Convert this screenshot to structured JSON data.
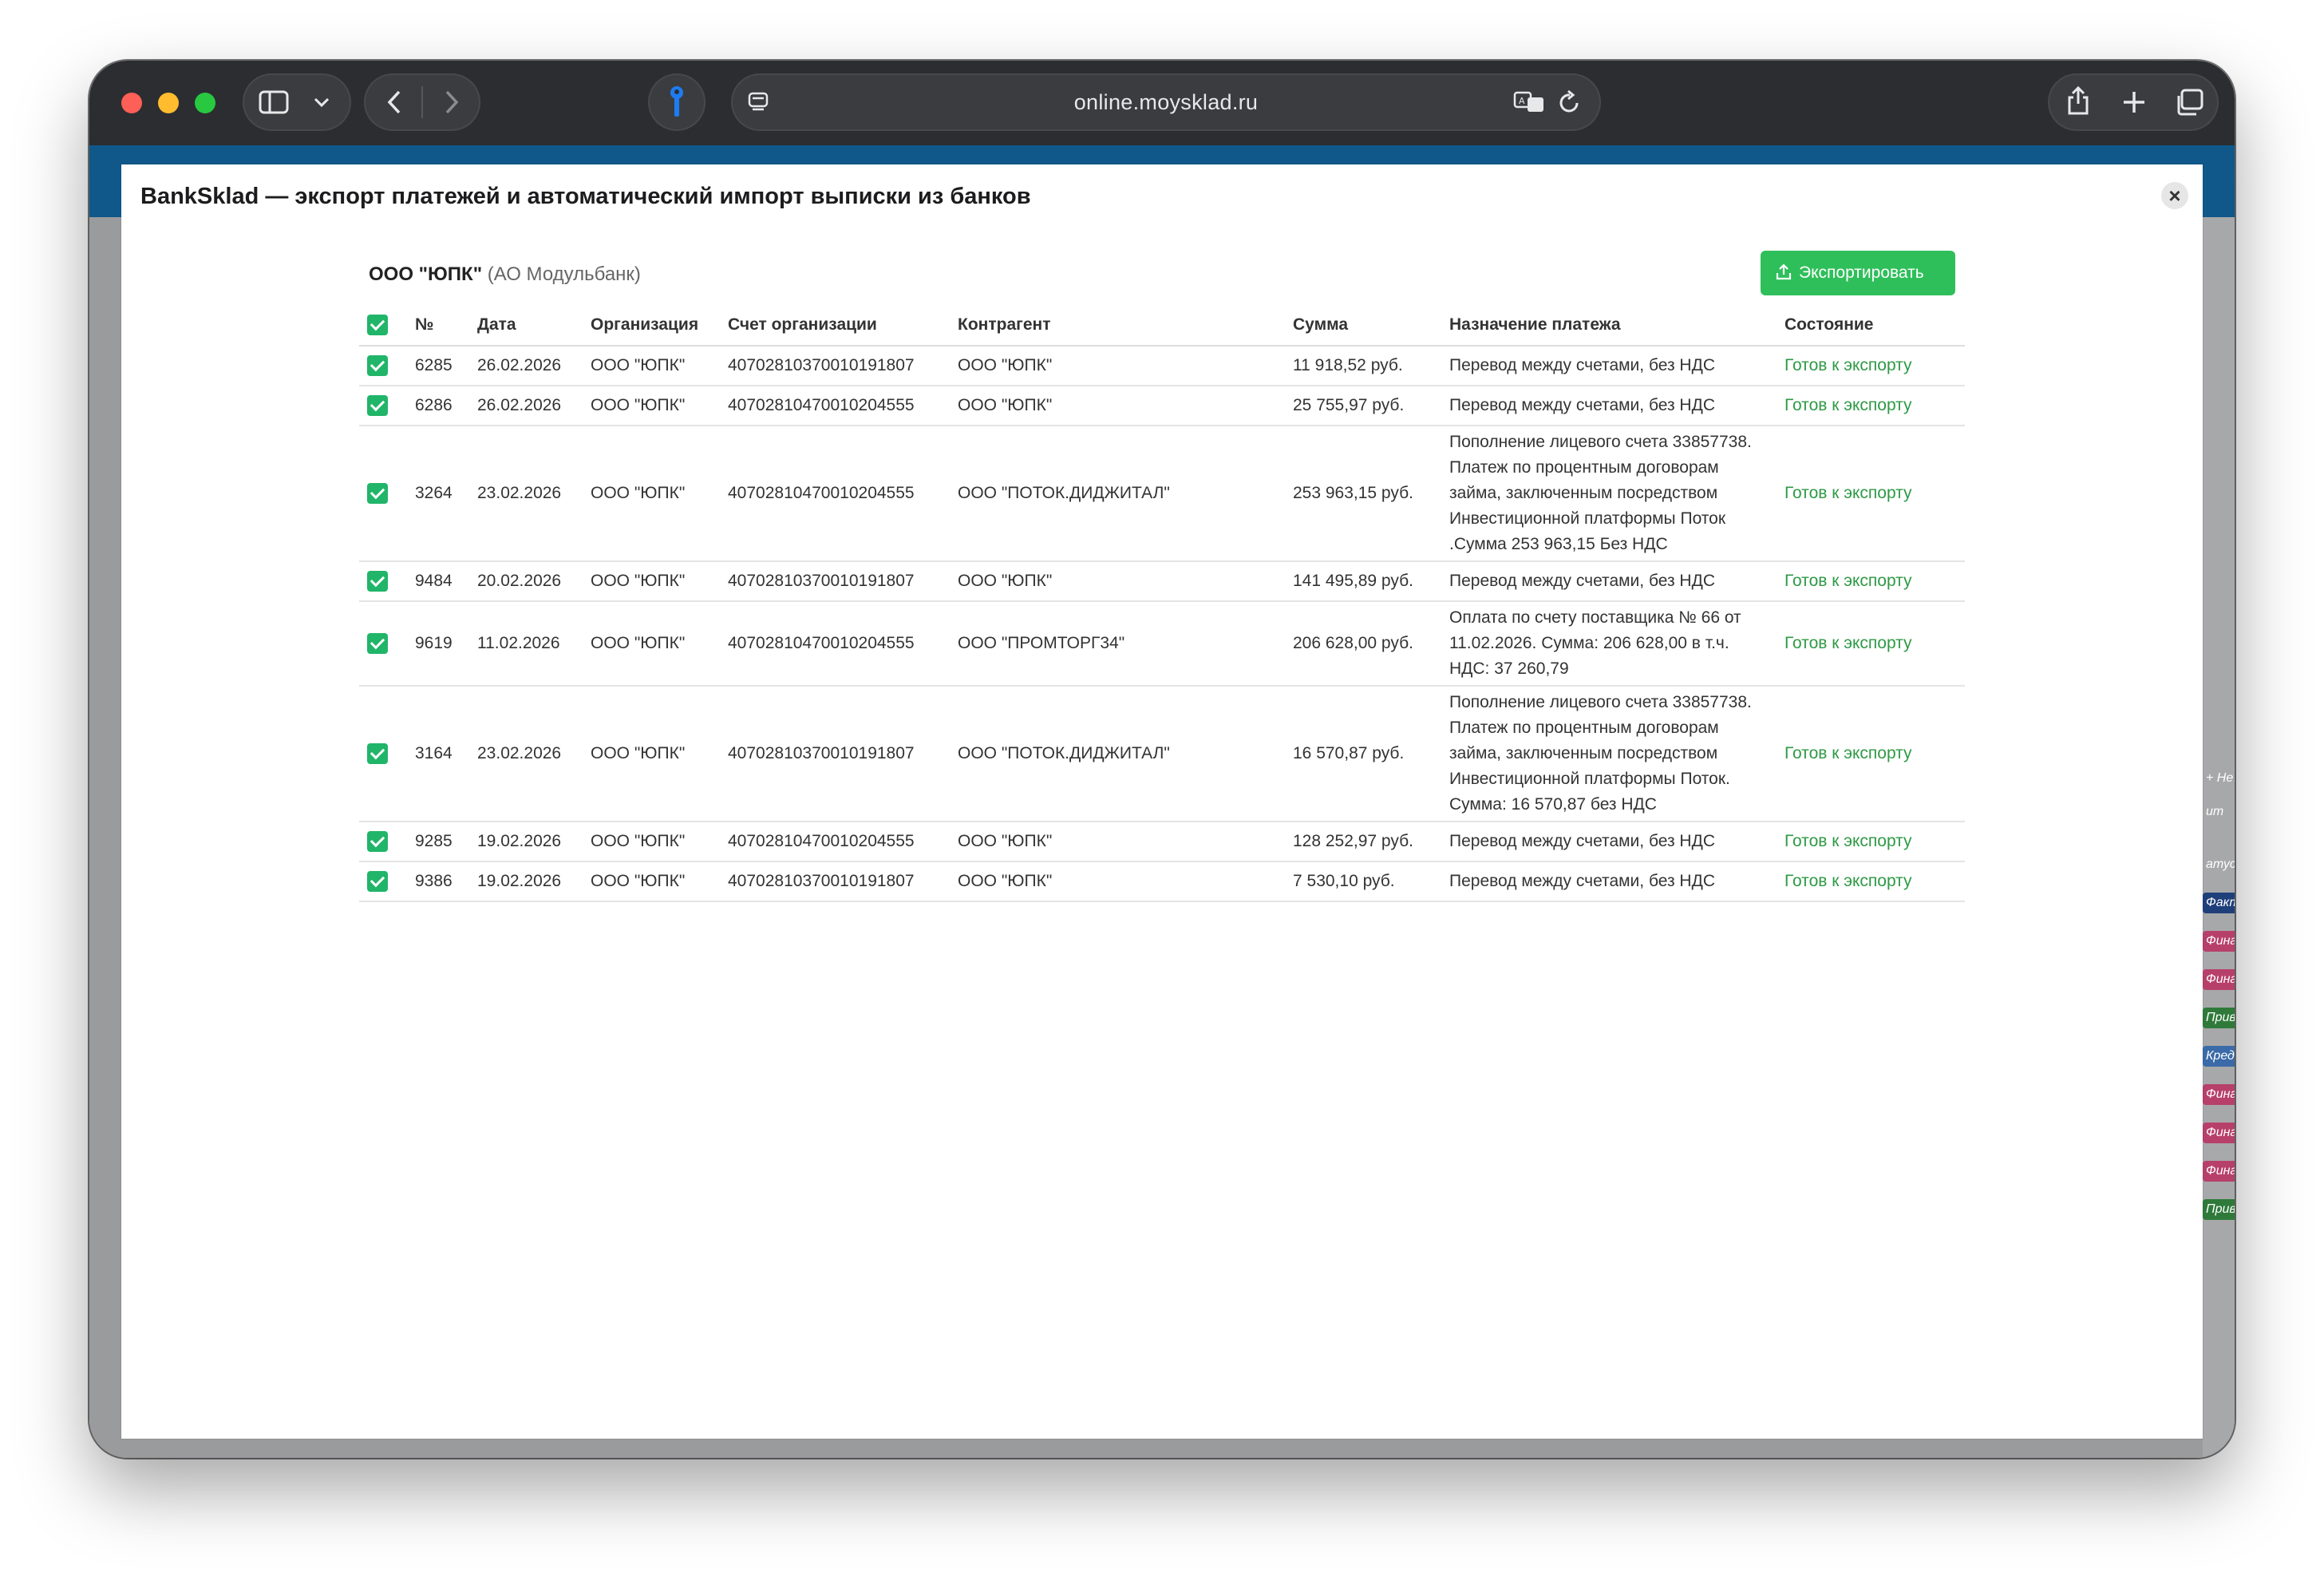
{
  "browser": {
    "url": "online.moysklad.ru"
  },
  "modal": {
    "title": "BankSklad — экспорт платежей и автоматический импорт выписки из банков",
    "close_label": "×",
    "company_name": "ООО \"ЮПК\"",
    "bank_name": "(АО Модульбанк)",
    "export_label": "Экспортировать"
  },
  "table": {
    "headers": {
      "num": "№",
      "date": "Дата",
      "org": "Организация",
      "account": "Счет организации",
      "counterparty": "Контрагент",
      "sum": "Сумма",
      "purpose": "Назначение платежа",
      "status": "Состояние"
    },
    "rows": [
      {
        "num": "6285",
        "date": "26.02.2026",
        "org": "ООО \"ЮПК\"",
        "account": "40702810370010191807",
        "counterparty": "ООО \"ЮПК\"",
        "sum": "11 918,52 руб.",
        "purpose": "Перевод между счетами, без НДС",
        "status": "Готов к экспорту"
      },
      {
        "num": "6286",
        "date": "26.02.2026",
        "org": "ООО \"ЮПК\"",
        "account": "40702810470010204555",
        "counterparty": "ООО \"ЮПК\"",
        "sum": "25 755,97 руб.",
        "purpose": "Перевод между счетами, без НДС",
        "status": "Готов к экспорту"
      },
      {
        "num": "3264",
        "date": "23.02.2026",
        "org": "ООО \"ЮПК\"",
        "account": "40702810470010204555",
        "counterparty": "ООО \"ПОТОК.ДИДЖИТАЛ\"",
        "sum": "253 963,15 руб.",
        "purpose": "Пополнение лицевого счета 33857738. Платеж по процентным договорам займа, заключенным посредством Инвестиционной платформы Поток .Сумма 253 963,15 Без НДС",
        "status": "Готов к экспорту"
      },
      {
        "num": "9484",
        "date": "20.02.2026",
        "org": "ООО \"ЮПК\"",
        "account": "40702810370010191807",
        "counterparty": "ООО \"ЮПК\"",
        "sum": "141 495,89 руб.",
        "purpose": "Перевод между счетами, без НДС",
        "status": "Готов к экспорту"
      },
      {
        "num": "9619",
        "date": "11.02.2026",
        "org": "ООО \"ЮПК\"",
        "account": "40702810470010204555",
        "counterparty": "ООО \"ПРОМТОРГ34\"",
        "sum": "206 628,00 руб.",
        "purpose": "Оплата по счету поставщика № 66 от 11.02.2026. Сумма: 206 628,00 в т.ч. НДС: 37 260,79",
        "status": "Готов к экспорту"
      },
      {
        "num": "3164",
        "date": "23.02.2026",
        "org": "ООО \"ЮПК\"",
        "account": "40702810370010191807",
        "counterparty": "ООО \"ПОТОК.ДИДЖИТАЛ\"",
        "sum": "16 570,87 руб.",
        "purpose": "Пополнение лицевого счета 33857738. Платеж по процентным договорам займа, заключенным посредством Инвестиционной платформы Поток. Сумма: 16 570,87 без НДС",
        "status": "Готов к экспорту"
      },
      {
        "num": "9285",
        "date": "19.02.2026",
        "org": "ООО \"ЮПК\"",
        "account": "40702810470010204555",
        "counterparty": "ООО \"ЮПК\"",
        "sum": "128 252,97 руб.",
        "purpose": "Перевод между счетами, без НДС",
        "status": "Готов к экспорту"
      },
      {
        "num": "9386",
        "date": "19.02.2026",
        "org": "ООО \"ЮПК\"",
        "account": "40702810370010191807",
        "counterparty": "ООО \"ЮПК\"",
        "sum": "7 530,10 руб.",
        "purpose": "Перевод между счетами, без НДС",
        "status": "Готов к экспорту"
      }
    ]
  },
  "background_tags": [
    {
      "text": "+ Не",
      "color": "#a7a8aa"
    },
    {
      "text": "ит Н",
      "color": "#a7a8aa"
    },
    {
      "text": "атус",
      "color": "#a7a8aa"
    },
    {
      "text": "Факт",
      "color": "#1f3f7a"
    },
    {
      "text": "Фина",
      "color": "#b7406a"
    },
    {
      "text": "Фина",
      "color": "#b7406a"
    },
    {
      "text": "Прив",
      "color": "#2f7a3a"
    },
    {
      "text": "Кред",
      "color": "#3a6aa8"
    },
    {
      "text": "Фина",
      "color": "#b7406a"
    },
    {
      "text": "Фина",
      "color": "#b7406a"
    },
    {
      "text": "Фина",
      "color": "#b7406a"
    },
    {
      "text": "Прив",
      "color": "#2f7a3a"
    }
  ]
}
